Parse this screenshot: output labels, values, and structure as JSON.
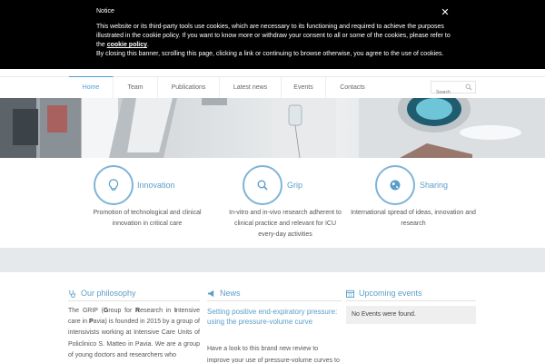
{
  "cookie": {
    "title": "Notice",
    "text_1": "This website or its third-party tools use cookies, which are necessary to its functioning and required to achieve the purposes illustrated in the cookie policy. If you want to know more or withdraw your consent to all or some of the cookies, please refer to the ",
    "policy_link": "cookie policy",
    "text_2": ".",
    "text_3": "By closing this banner, scrolling this page, clicking a link or continuing to browse otherwise, you agree to the use of cookies.",
    "close": "✕"
  },
  "nav": {
    "items": [
      {
        "label": "Home"
      },
      {
        "label": "Team"
      },
      {
        "label": "Publications"
      },
      {
        "label": "Latest news"
      },
      {
        "label": "Events"
      },
      {
        "label": "Contacts"
      }
    ],
    "search_placeholder": "Search"
  },
  "features": [
    {
      "title": "Innovation",
      "icon": "lightbulb-icon",
      "desc_1": "Promotion of technological and clinical",
      "desc_2": "innovation in critical care"
    },
    {
      "title": "Grip",
      "icon": "search-icon",
      "desc_1": "In-vitro and in-vivo research adherent to",
      "desc_2": "clinical practice and relevant for ICU",
      "desc_3": "every-day activities"
    },
    {
      "title": "Sharing",
      "icon": "globe-icon",
      "desc_1": "International spread of ideas, innovation and",
      "desc_2": "research"
    }
  ],
  "philosophy": {
    "heading": "Our philosophy",
    "t1": "The GRIP (",
    "g": "G",
    "t2": "roup for ",
    "r": "R",
    "t3": "esearch in ",
    "i": "I",
    "t4": "ntensive care in ",
    "p": "P",
    "t5": "avia) is founded in 2015 by a group of intensivists working at Intensive Care Units of Policlinico S. Matteo in Pavia. We are a group of young doctors and researchers who"
  },
  "news": {
    "heading": "News",
    "title": "Setting positive end-expiratory pressure: using the pressure-volume curve",
    "text": "Have a look to this brand new review to improve your use of pressure-volume curves to"
  },
  "events": {
    "heading": "Upcoming events",
    "empty": "No Events were found."
  },
  "colors": {
    "accent": "#5a9ec9",
    "circle": "#7fb4d6",
    "band": "#e5e9ec"
  }
}
